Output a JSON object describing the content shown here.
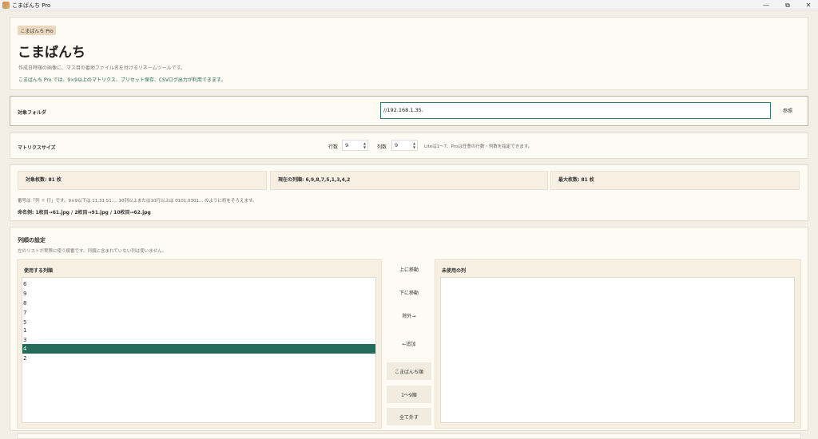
{
  "window": {
    "title": "こまばんち Pro",
    "minimize": "—",
    "maximize": "⧉",
    "close": "✕"
  },
  "header": {
    "badge": "こまばんち Pro",
    "title": "こまばんち",
    "description": "作成日時順の画像に、マス目の番地ファイル名を付けるリネームツールです。",
    "pro_note": "こまばんち Pro では、9×9以上のマトリクス、プリセット保存、CSVログ出力が利用できます。"
  },
  "folder": {
    "label": "対象フォルダ",
    "value": "//192.168.1.35.",
    "browse_label": "参照"
  },
  "matrix": {
    "label": "マトリクスサイズ",
    "rows_label": "行数",
    "rows_value": "9",
    "cols_label": "列数",
    "cols_value": "9",
    "hint": "Liteは1〜7、Proは任意の行数・列数を指定できます。"
  },
  "stats": {
    "target_count": "対象枚数: 81 枚",
    "current_order": "現在の列順: 6,9,8,7,5,1,3,4,2",
    "max_count": "最大枚数: 81 枚",
    "note": "番号は「列 ＋ 行」です。9×9以下は 11,31,51.... 10列以上または10行以上は 0101,0301... のように桁をそろえます。",
    "example": "命名例: 1枚目→61.jpg / 2枚目→91.jpg / 10枚目→62.jpg"
  },
  "order": {
    "title": "列順の設定",
    "hint": "左のリストが実際に使う順番です。列順に含まれていない列は使いません。",
    "used_title": "使用する列順",
    "unused_title": "未使用の列",
    "used_items": [
      "6",
      "9",
      "8",
      "7",
      "5",
      "1",
      "3",
      "4",
      "2"
    ],
    "selected_index": 7,
    "buttons": {
      "move_up": "上に移動",
      "move_down": "下に移動",
      "remove": "除外→",
      "add": "←追加",
      "komabanchi_order": "こまばんち順",
      "one_to_nine": "1〜9順",
      "remove_all": "全て外す"
    }
  }
}
